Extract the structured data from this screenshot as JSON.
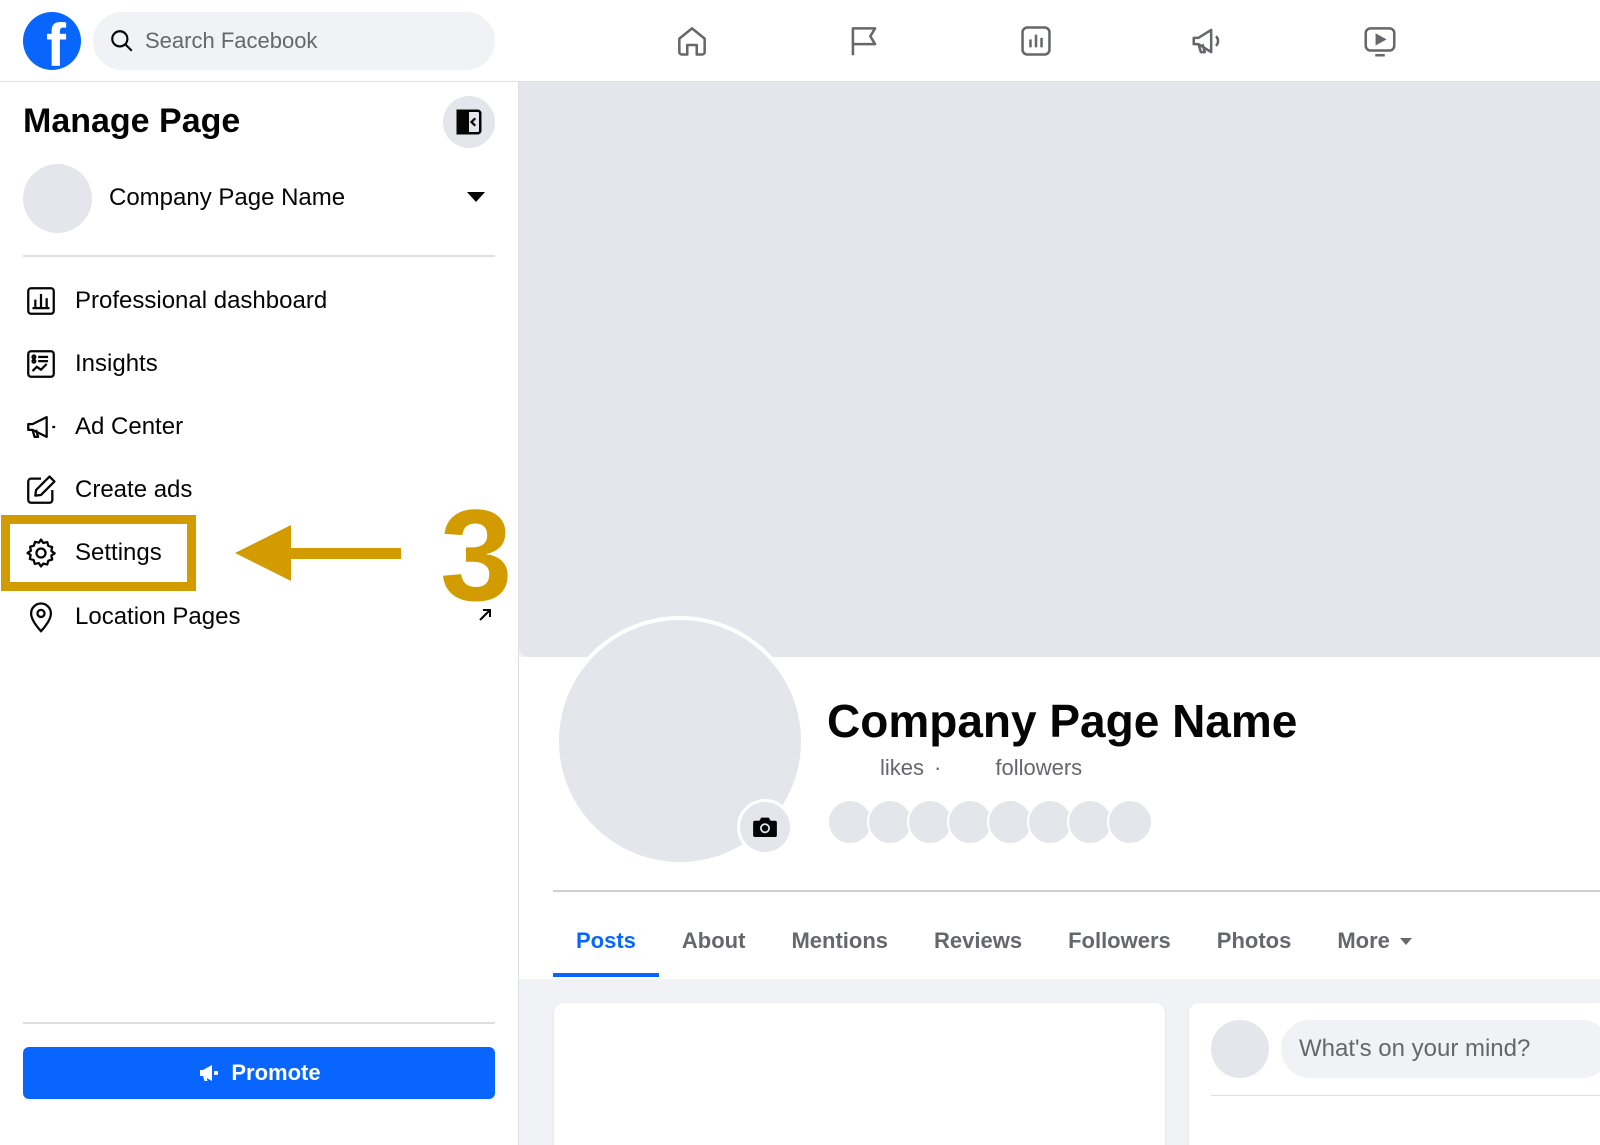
{
  "topbar": {
    "logo_letter": "f",
    "search_placeholder": "Search Facebook",
    "nav_icons": [
      "home-icon",
      "flag-icon",
      "insights-chart-icon",
      "megaphone-icon",
      "video-icon"
    ]
  },
  "sidebar": {
    "title": "Manage Page",
    "page_name": "Company Page Name",
    "items": [
      {
        "label": "Professional dashboard",
        "icon": "dashboard-icon"
      },
      {
        "label": "Insights",
        "icon": "insights-icon"
      },
      {
        "label": "Ad Center",
        "icon": "megaphone-icon"
      },
      {
        "label": "Create ads",
        "icon": "edit-icon"
      },
      {
        "label": "Settings",
        "icon": "gear-icon"
      },
      {
        "label": "Location Pages",
        "icon": "location-pin-icon"
      }
    ],
    "promote_label": "Promote"
  },
  "annotation": {
    "step": "3",
    "color": "#d29b00"
  },
  "profile": {
    "name": "Company Page Name",
    "likes_label": "likes",
    "dot": "·",
    "followers_label": "followers"
  },
  "tabs": [
    {
      "label": "Posts",
      "active": true
    },
    {
      "label": "About",
      "active": false
    },
    {
      "label": "Mentions",
      "active": false
    },
    {
      "label": "Reviews",
      "active": false
    },
    {
      "label": "Followers",
      "active": false
    },
    {
      "label": "Photos",
      "active": false
    },
    {
      "label": "More",
      "active": false
    }
  ],
  "composer": {
    "placeholder": "What's on your mind?"
  },
  "colors": {
    "brand": "#0866ff",
    "annotation": "#d29b00",
    "placeholder_gray": "#e4e6eb"
  }
}
